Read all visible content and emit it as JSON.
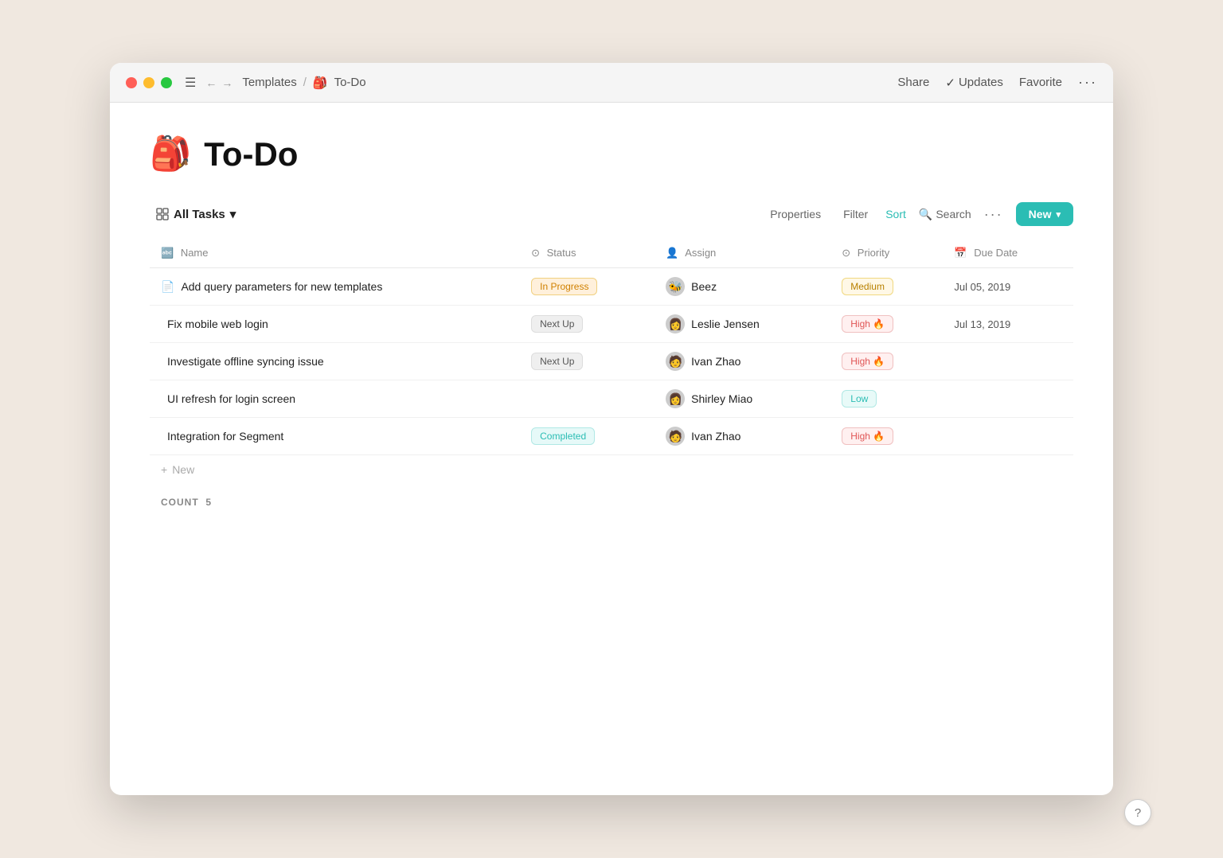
{
  "window": {
    "title": "To-Do",
    "breadcrumb": {
      "parent": "Templates",
      "current": "To-Do"
    },
    "titlebar_actions": {
      "share": "Share",
      "updates": "Updates",
      "favorite": "Favorite",
      "more": "···"
    }
  },
  "page": {
    "emoji": "🎒",
    "title": "To-Do"
  },
  "toolbar": {
    "view_label": "All Tasks",
    "properties": "Properties",
    "filter": "Filter",
    "sort": "Sort",
    "search": "Search",
    "more": "···",
    "new_btn": "New"
  },
  "table": {
    "columns": [
      {
        "id": "name",
        "label": "Name",
        "icon": "text-icon"
      },
      {
        "id": "status",
        "label": "Status",
        "icon": "circle-icon"
      },
      {
        "id": "assign",
        "label": "Assign",
        "icon": "person-icon"
      },
      {
        "id": "priority",
        "label": "Priority",
        "icon": "target-icon"
      },
      {
        "id": "due_date",
        "label": "Due Date",
        "icon": "calendar-icon"
      }
    ],
    "rows": [
      {
        "id": 1,
        "name": "Add query parameters for new templates",
        "has_doc_icon": true,
        "status": "In Progress",
        "status_type": "inprogress",
        "assignee": "Beez",
        "assignee_emoji": "🐝",
        "priority": "Medium",
        "priority_type": "medium",
        "priority_emoji": "",
        "due_date": "Jul 05, 2019"
      },
      {
        "id": 2,
        "name": "Fix mobile web login",
        "has_doc_icon": false,
        "status": "Next Up",
        "status_type": "nextup",
        "assignee": "Leslie Jensen",
        "assignee_emoji": "👩",
        "priority": "High 🔥",
        "priority_type": "high",
        "priority_emoji": "🔥",
        "due_date": "Jul 13, 2019"
      },
      {
        "id": 3,
        "name": "Investigate offline syncing issue",
        "has_doc_icon": false,
        "status": "Next Up",
        "status_type": "nextup",
        "assignee": "Ivan Zhao",
        "assignee_emoji": "🧑",
        "priority": "High 🔥",
        "priority_type": "high",
        "priority_emoji": "🔥",
        "due_date": ""
      },
      {
        "id": 4,
        "name": "UI refresh for login screen",
        "has_doc_icon": false,
        "status": "",
        "status_type": "none",
        "assignee": "Shirley Miao",
        "assignee_emoji": "👩",
        "priority": "Low",
        "priority_type": "low",
        "priority_emoji": "",
        "due_date": ""
      },
      {
        "id": 5,
        "name": "Integration for Segment",
        "has_doc_icon": false,
        "status": "Completed",
        "status_type": "completed",
        "assignee": "Ivan Zhao",
        "assignee_emoji": "🧑",
        "priority": "High 🔥",
        "priority_type": "high",
        "priority_emoji": "🔥",
        "due_date": ""
      }
    ],
    "add_new_label": "New",
    "count_label": "COUNT",
    "count": "5"
  },
  "help": "?"
}
